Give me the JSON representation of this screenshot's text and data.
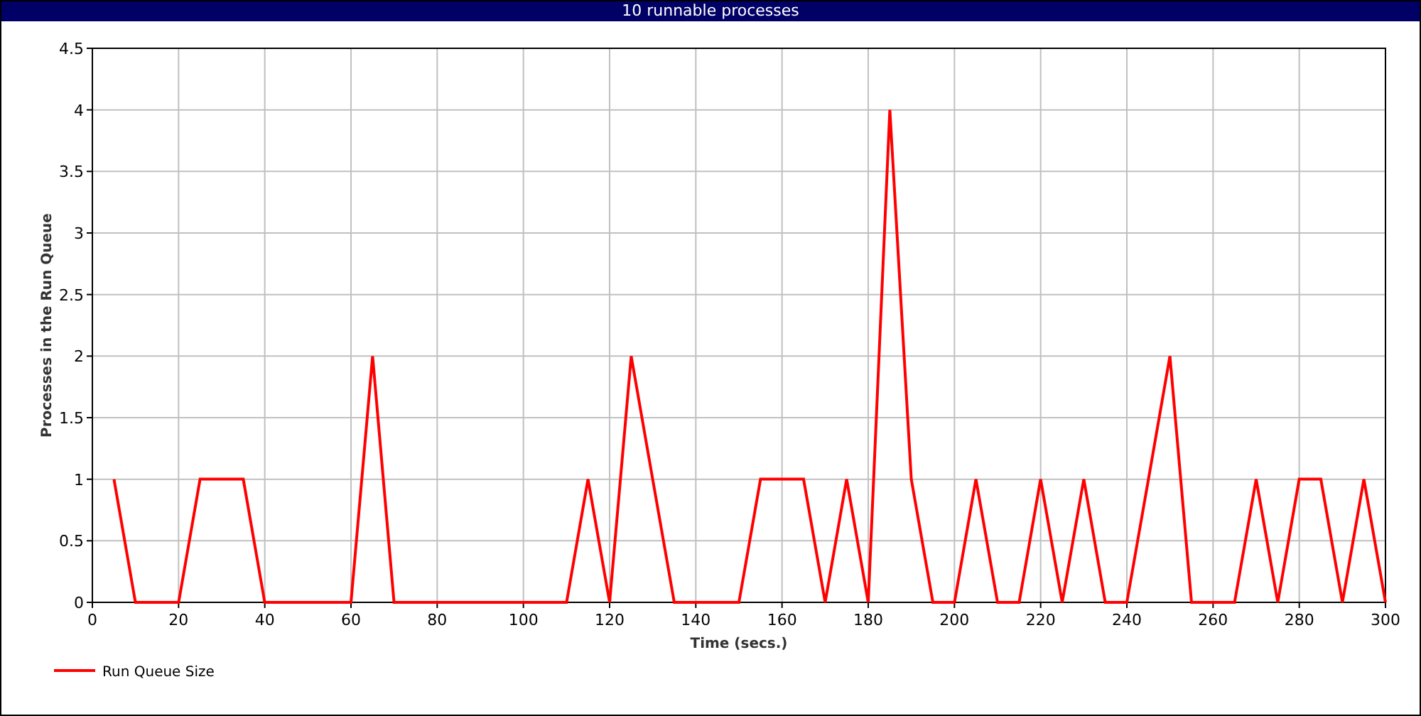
{
  "chart": {
    "chart_data": {
      "type": "line",
      "title": "10 runnable processes",
      "xlabel": "Time (secs.)",
      "ylabel": "Processes in the Run Queue",
      "x": [
        5,
        10,
        15,
        20,
        25,
        30,
        35,
        40,
        45,
        50,
        55,
        60,
        65,
        70,
        75,
        80,
        85,
        90,
        95,
        100,
        105,
        110,
        115,
        120,
        125,
        130,
        135,
        140,
        145,
        150,
        155,
        160,
        165,
        170,
        175,
        180,
        185,
        190,
        195,
        200,
        205,
        210,
        215,
        220,
        225,
        230,
        235,
        240,
        245,
        250,
        255,
        260,
        265,
        270,
        275,
        280,
        285,
        290,
        295,
        300
      ],
      "series": [
        {
          "name": "Run Queue Size",
          "color": "#ff0000",
          "values": [
            1,
            0,
            0,
            0,
            1,
            1,
            1,
            0,
            0,
            0,
            0,
            0,
            2,
            0,
            0,
            0,
            0,
            0,
            0,
            0,
            0,
            0,
            1,
            0,
            2,
            1,
            0,
            0,
            0,
            0,
            1,
            1,
            1,
            0,
            1,
            0,
            4,
            1,
            0,
            0,
            1,
            0,
            0,
            1,
            0,
            1,
            0,
            0,
            1,
            2,
            0,
            0,
            0,
            1,
            0,
            1,
            1,
            0,
            1,
            0
          ]
        }
      ],
      "grid": true,
      "xlim": [
        0,
        300
      ],
      "ylim": [
        0,
        4.5
      ],
      "xticks": [
        0,
        20,
        40,
        60,
        80,
        100,
        120,
        140,
        160,
        180,
        200,
        220,
        240,
        260,
        280,
        300
      ],
      "yticks": [
        0,
        0.5,
        1,
        1.5,
        2,
        2.5,
        3,
        3.5,
        4,
        4.5
      ]
    }
  }
}
